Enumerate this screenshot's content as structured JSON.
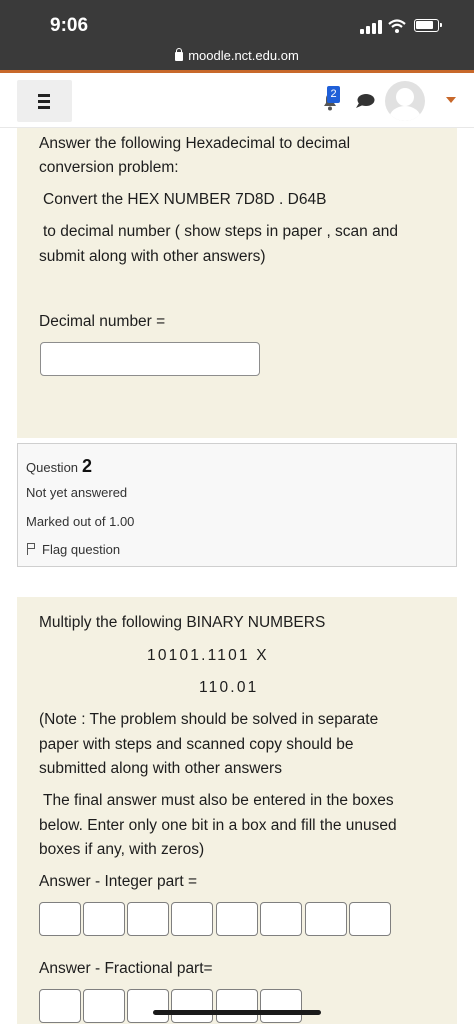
{
  "status_bar": {
    "time": "9:06"
  },
  "browser": {
    "url": "moodle.nct.edu.om"
  },
  "navbar": {
    "notification_count": "2"
  },
  "question1": {
    "lines": [
      "Answer the following Hexadecimal to decimal",
      "conversion problem:",
      "Convert the HEX NUMBER  7D8D .  D64B",
      "to decimal number ( show steps in paper , scan and",
      "submit along with other answers)"
    ],
    "decimal_label": "Decimal number =",
    "decimal_value": ""
  },
  "question2_info": {
    "label": "Question",
    "number": "2",
    "status": "Not yet answered",
    "marks": "Marked out of 1.00",
    "flag_label": "Flag question"
  },
  "question2": {
    "intro": "Multiply the  following BINARY NUMBERS",
    "operand1": "10101.1101  X",
    "operand2": "110.01",
    "note_lines": [
      "(Note :    The problem should be solved  in separate",
      "paper with steps  and  scanned copy should be",
      "submitted along with other answers",
      "The final answer  must also be entered in the boxes",
      "below.  Enter only one bit in a box and fill the unused",
      "boxes if any, with zeros)"
    ],
    "integer_label": "Answer  - Integer part =",
    "fraction_label": "Answer - Fractional part=",
    "integer_bits": [
      "",
      "",
      "",
      "",
      "",
      "",
      "",
      ""
    ],
    "fraction_bits": [
      "",
      "",
      "",
      "",
      "",
      ""
    ]
  }
}
